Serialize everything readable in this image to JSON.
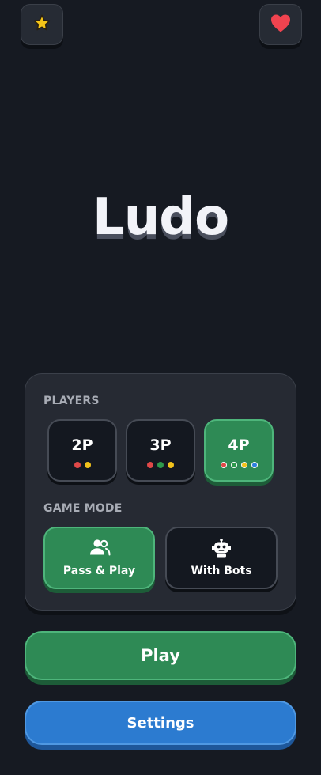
{
  "top_bar": {
    "left_icon": "star-icon",
    "right_icon": "heart-icon",
    "star_color": "#f5c518",
    "heart_color": "#f0434f"
  },
  "title": "Ludo",
  "players": {
    "label": "PLAYERS",
    "selected": "4P",
    "options": [
      {
        "label": "2P",
        "dot_colors": [
          "#e04848",
          "#f2c21b"
        ]
      },
      {
        "label": "3P",
        "dot_colors": [
          "#e04848",
          "#2e9a4c",
          "#f2c21b"
        ]
      },
      {
        "label": "4P",
        "dot_colors": [
          "#e04848",
          "#2e9a4c",
          "#f2c21b",
          "#2f7fe0"
        ]
      }
    ]
  },
  "game_mode": {
    "label": "GAME MODE",
    "selected": "Pass & Play",
    "options": [
      {
        "label": "Pass & Play",
        "icon": "users-icon"
      },
      {
        "label": "With Bots",
        "icon": "robot-icon"
      }
    ]
  },
  "actions": {
    "play_label": "Play",
    "settings_label": "Settings"
  },
  "colors": {
    "background": "#161a22",
    "accent_green": "#2e8a55",
    "accent_blue": "#2c7bd0"
  }
}
